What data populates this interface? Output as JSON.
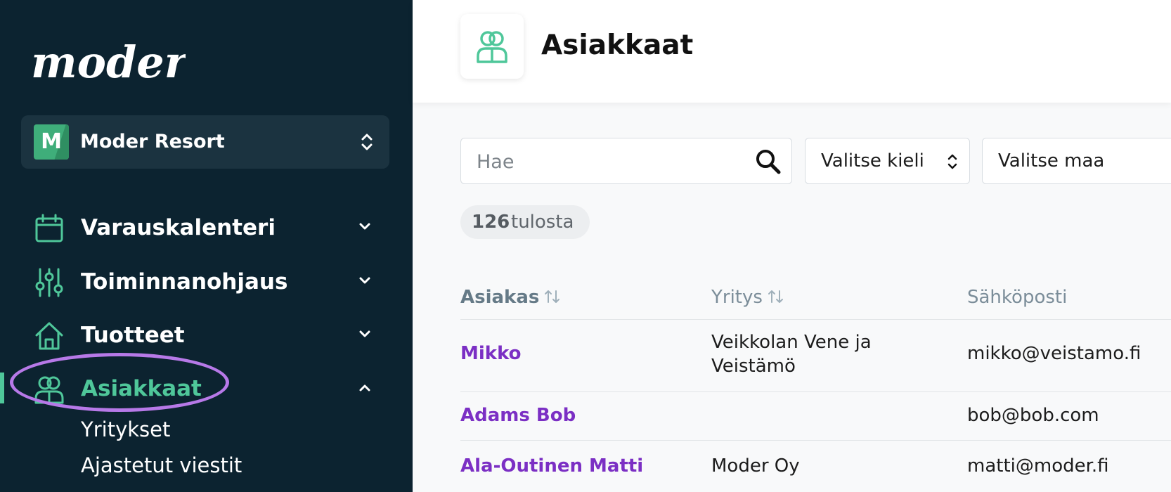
{
  "sidebar": {
    "logo_text": "moder",
    "org": {
      "badge_letter": "M",
      "name": "Moder Resort",
      "icon": "chevron-updown-icon"
    },
    "nav": [
      {
        "label": "Varauskalenteri",
        "icon": "calendar-icon",
        "expanded": false
      },
      {
        "label": "Toiminnanohjaus",
        "icon": "sliders-icon",
        "expanded": false
      },
      {
        "label": "Tuotteet",
        "icon": "home-icon",
        "expanded": false
      },
      {
        "label": "Asiakkaat",
        "icon": "users-icon",
        "expanded": true,
        "active": true
      }
    ],
    "sub_items": [
      "Yritykset",
      "Ajastetut viestit"
    ]
  },
  "header": {
    "title": "Asiakkaat",
    "icon": "users-icon"
  },
  "filters": {
    "search_placeholder": "Hae",
    "language_select": "Valitse kieli",
    "country_select": "Valitse maa"
  },
  "results": {
    "count": "126",
    "label": "tulosta"
  },
  "table": {
    "columns": [
      {
        "label": "Asiakas",
        "sortable": true
      },
      {
        "label": "Yritys",
        "sortable": true
      },
      {
        "label": "Sähköposti",
        "sortable": false
      }
    ],
    "rows": [
      {
        "name": "Mikko",
        "company": "Veikkolan Vene ja Veistämö",
        "email": "mikko@veistamo.fi"
      },
      {
        "name": "Adams Bob",
        "company": "",
        "email": "bob@bob.com"
      },
      {
        "name": "Ala-Outinen Matti",
        "company": "Moder Oy",
        "email": "matti@moder.fi"
      }
    ]
  },
  "colors": {
    "sidebar_bg": "#0c2330",
    "accent_green": "#4fc79a",
    "link_purple": "#7b2fc4",
    "highlight_ring": "#b779e8"
  }
}
